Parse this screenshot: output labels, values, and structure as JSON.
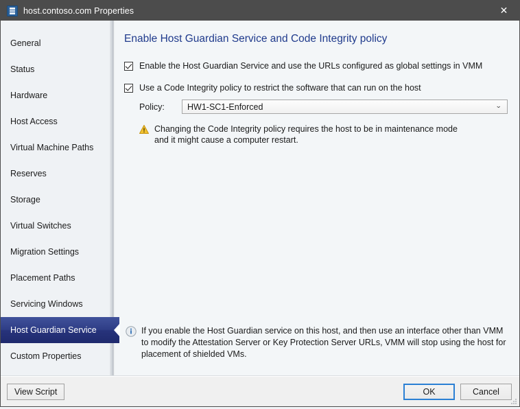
{
  "titlebar": {
    "title": "host.contoso.com Properties",
    "icon": "server-properties-icon",
    "close_label": "✕"
  },
  "sidebar": {
    "items": [
      {
        "label": "General",
        "selected": false
      },
      {
        "label": "Status",
        "selected": false
      },
      {
        "label": "Hardware",
        "selected": false
      },
      {
        "label": "Host Access",
        "selected": false
      },
      {
        "label": "Virtual Machine Paths",
        "selected": false
      },
      {
        "label": "Reserves",
        "selected": false
      },
      {
        "label": "Storage",
        "selected": false
      },
      {
        "label": "Virtual Switches",
        "selected": false
      },
      {
        "label": "Migration Settings",
        "selected": false
      },
      {
        "label": "Placement Paths",
        "selected": false
      },
      {
        "label": "Servicing Windows",
        "selected": false
      },
      {
        "label": "Host Guardian Service",
        "selected": true
      },
      {
        "label": "Custom Properties",
        "selected": false
      }
    ]
  },
  "content": {
    "title": "Enable Host Guardian Service and Code Integrity policy",
    "checkbox_hgs": {
      "label": "Enable the Host Guardian Service and use the URLs configured as global settings in VMM",
      "checked": true
    },
    "checkbox_ci": {
      "label": "Use a Code Integrity policy to restrict the software that can run on the host",
      "checked": true
    },
    "policy": {
      "label": "Policy:",
      "value": "HW1-SC1-Enforced",
      "chevron": "⌄"
    },
    "warning": {
      "icon": "warning-triangle-icon",
      "text": "Changing the Code Integrity policy requires the host to be in maintenance mode and it might cause a computer restart."
    },
    "info": {
      "icon": "info-circle-icon",
      "text": "If you enable the Host Guardian service on this host, and then use an interface other than VMM to modify the Attestation Server or Key Protection Server URLs, VMM will stop using the host for placement of shielded VMs."
    }
  },
  "footer": {
    "view_script_label": "View Script",
    "ok_label": "OK",
    "cancel_label": "Cancel"
  },
  "colors": {
    "titlebar_bg": "#4c4c4c",
    "selected_nav_bg": "#2e3d86",
    "heading": "#1f3a8c",
    "focus_border": "#2a7fd4",
    "warning": "#e8a317",
    "content_bg": "#f3f6f8"
  }
}
